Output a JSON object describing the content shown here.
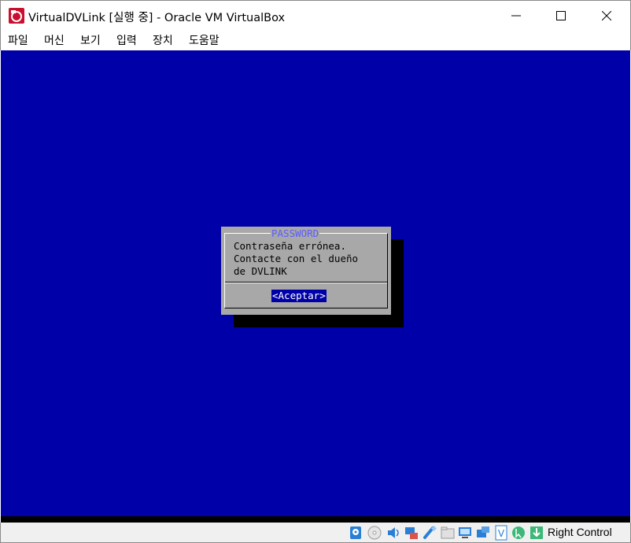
{
  "window": {
    "title": "VirtualDVLink [실행 중] - Oracle VM VirtualBox",
    "controls": [
      "minimize",
      "maximize",
      "close"
    ]
  },
  "menu": {
    "items": [
      "파일",
      "머신",
      "보기",
      "입력",
      "장치",
      "도움말"
    ]
  },
  "vm": {
    "background_color": "#0000a8",
    "dialog": {
      "title": "PASSWORD",
      "lines": [
        "Contraseña errónea.",
        "Contacte con el dueño",
        "de DVLINK"
      ],
      "button_label": "<Aceptar>",
      "dialog_bg": "#a8a8a8",
      "title_color": "#5c5cff"
    }
  },
  "statusbar": {
    "icons": [
      "hard-disk-icon",
      "optical-drive-icon",
      "audio-icon",
      "network-icon",
      "usb-icon",
      "shared-folders-icon",
      "display-icon",
      "recording-icon",
      "vt-x-icon",
      "mouse-integration-icon",
      "keyboard-capture-icon"
    ],
    "host_key_label": "Right Control"
  }
}
